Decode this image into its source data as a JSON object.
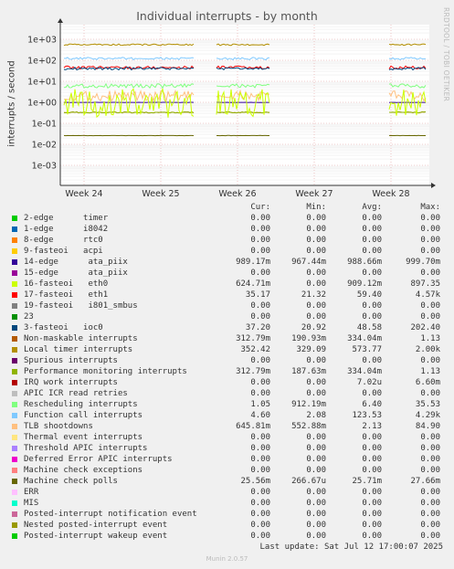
{
  "chart_data": {
    "type": "line",
    "title": "Individual interrupts - by month",
    "ylabel": "interrupts / second",
    "yscale": "log",
    "ylim": [
      0.0001,
      4000
    ],
    "ytick_labels": [
      "1e+03",
      "1e+02",
      "1e+01",
      "1e+00",
      "1e-01",
      "1e-02",
      "1e-03"
    ],
    "x_tick_labels": [
      "Week 24",
      "Week 25",
      "Week 26",
      "Week 27",
      "Week 28"
    ],
    "grid": true
  },
  "side_label": "RRDTOOL / TOBI OETIKER",
  "columns": [
    "Cur:",
    "Min:",
    "Avg:",
    "Max:"
  ],
  "series": [
    {
      "name": "2-edge      timer",
      "color": "#00cc00",
      "cur": "0.00",
      "min": "0.00",
      "avg": "0.00",
      "max": "0.00"
    },
    {
      "name": "1-edge      i8042",
      "color": "#0066b3",
      "cur": "0.00",
      "min": "0.00",
      "avg": "0.00",
      "max": "0.00"
    },
    {
      "name": "8-edge      rtc0",
      "color": "#ff8000",
      "cur": "0.00",
      "min": "0.00",
      "avg": "0.00",
      "max": "0.00"
    },
    {
      "name": "9-fasteoi   acpi",
      "color": "#ffcc00",
      "cur": "0.00",
      "min": "0.00",
      "avg": "0.00",
      "max": "0.00"
    },
    {
      "name": "14-edge      ata_piix",
      "color": "#330099",
      "cur": "989.17m",
      "min": "967.44m",
      "avg": "988.66m",
      "max": "999.70m"
    },
    {
      "name": "15-edge      ata_piix",
      "color": "#990099",
      "cur": "0.00",
      "min": "0.00",
      "avg": "0.00",
      "max": "0.00"
    },
    {
      "name": "16-fasteoi   eth0",
      "color": "#ccff00",
      "cur": "624.71m",
      "min": "0.00",
      "avg": "909.12m",
      "max": "897.35"
    },
    {
      "name": "17-fasteoi   eth1",
      "color": "#ff0000",
      "cur": "35.17",
      "min": "21.32",
      "avg": "59.40",
      "max": "4.57k"
    },
    {
      "name": "19-fasteoi   i801_smbus",
      "color": "#808080",
      "cur": "0.00",
      "min": "0.00",
      "avg": "0.00",
      "max": "0.00"
    },
    {
      "name": "23",
      "color": "#008f00",
      "cur": "0.00",
      "min": "0.00",
      "avg": "0.00",
      "max": "0.00"
    },
    {
      "name": "3-fasteoi   ioc0",
      "color": "#00487d",
      "cur": "37.20",
      "min": "20.92",
      "avg": "48.58",
      "max": "202.40"
    },
    {
      "name": "Non-maskable interrupts",
      "color": "#b35a00",
      "cur": "312.79m",
      "min": "190.93m",
      "avg": "334.04m",
      "max": "1.13"
    },
    {
      "name": "Local timer interrupts",
      "color": "#b38f00",
      "cur": "352.42",
      "min": "329.09",
      "avg": "573.77",
      "max": "2.00k"
    },
    {
      "name": "Spurious interrupts",
      "color": "#6b006b",
      "cur": "0.00",
      "min": "0.00",
      "avg": "0.00",
      "max": "0.00"
    },
    {
      "name": "Performance monitoring interrupts",
      "color": "#8fb300",
      "cur": "312.79m",
      "min": "187.63m",
      "avg": "334.04m",
      "max": "1.13"
    },
    {
      "name": "IRQ work interrupts",
      "color": "#b30000",
      "cur": "0.00",
      "min": "0.00",
      "avg": "7.02u",
      "max": "6.60m"
    },
    {
      "name": "APIC ICR read retries",
      "color": "#bebebe",
      "cur": "0.00",
      "min": "0.00",
      "avg": "0.00",
      "max": "0.00"
    },
    {
      "name": "Rescheduling interrupts",
      "color": "#80ff80",
      "cur": "1.05",
      "min": "912.19m",
      "avg": "6.40",
      "max": "35.53"
    },
    {
      "name": "Function call interrupts",
      "color": "#80c9ff",
      "cur": "4.60",
      "min": "2.08",
      "avg": "123.53",
      "max": "4.29k"
    },
    {
      "name": "TLB shootdowns",
      "color": "#ffc080",
      "cur": "645.81m",
      "min": "552.88m",
      "avg": "2.13",
      "max": "84.90"
    },
    {
      "name": "Thermal event interrupts",
      "color": "#ffe680",
      "cur": "0.00",
      "min": "0.00",
      "avg": "0.00",
      "max": "0.00"
    },
    {
      "name": "Threshold APIC interrupts",
      "color": "#aa80ff",
      "cur": "0.00",
      "min": "0.00",
      "avg": "0.00",
      "max": "0.00"
    },
    {
      "name": "Deferred Error APIC interrupts",
      "color": "#ee00cc",
      "cur": "0.00",
      "min": "0.00",
      "avg": "0.00",
      "max": "0.00"
    },
    {
      "name": "Machine check exceptions",
      "color": "#ff8080",
      "cur": "0.00",
      "min": "0.00",
      "avg": "0.00",
      "max": "0.00"
    },
    {
      "name": "Machine check polls",
      "color": "#666600",
      "cur": "25.56m",
      "min": "266.67u",
      "avg": "25.71m",
      "max": "27.66m"
    },
    {
      "name": "ERR",
      "color": "#ffbfff",
      "cur": "0.00",
      "min": "0.00",
      "avg": "0.00",
      "max": "0.00"
    },
    {
      "name": "MIS",
      "color": "#00ffcc",
      "cur": "0.00",
      "min": "0.00",
      "avg": "0.00",
      "max": "0.00"
    },
    {
      "name": "Posted-interrupt notification event",
      "color": "#cc6699",
      "cur": "0.00",
      "min": "0.00",
      "avg": "0.00",
      "max": "0.00"
    },
    {
      "name": "Nested posted-interrupt event",
      "color": "#999900",
      "cur": "0.00",
      "min": "0.00",
      "avg": "0.00",
      "max": "0.00"
    },
    {
      "name": "Posted-interrupt wakeup event",
      "color": "#00cc00",
      "cur": "0.00",
      "min": "0.00",
      "avg": "0.00",
      "max": "0.00"
    }
  ],
  "last_update": "Last update: Sat Jul 12 17:00:07 2025",
  "footer": "Munin 2.0.57"
}
